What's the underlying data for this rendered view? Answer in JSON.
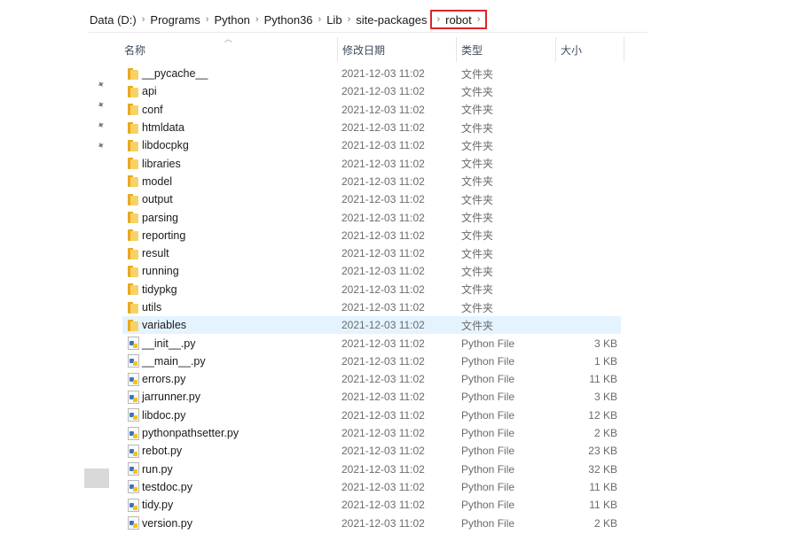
{
  "breadcrumb": {
    "items": [
      "Data (D:)",
      "Programs",
      "Python",
      "Python36",
      "Lib",
      "site-packages"
    ],
    "current": "robot",
    "separator": "›"
  },
  "columns": {
    "name": "名称",
    "date": "修改日期",
    "type": "类型",
    "size": "大小"
  },
  "colors": {
    "highlight_border": "#e0242b",
    "selected_row": "#e5f3ff"
  },
  "files": [
    {
      "icon": "folder-icon",
      "name": "__pycache__",
      "date": "2021-12-03 11:02",
      "type": "文件夹",
      "size": ""
    },
    {
      "icon": "folder-icon",
      "name": "api",
      "date": "2021-12-03 11:02",
      "type": "文件夹",
      "size": ""
    },
    {
      "icon": "folder-icon",
      "name": "conf",
      "date": "2021-12-03 11:02",
      "type": "文件夹",
      "size": ""
    },
    {
      "icon": "folder-icon",
      "name": "htmldata",
      "date": "2021-12-03 11:02",
      "type": "文件夹",
      "size": ""
    },
    {
      "icon": "folder-icon",
      "name": "libdocpkg",
      "date": "2021-12-03 11:02",
      "type": "文件夹",
      "size": ""
    },
    {
      "icon": "folder-icon",
      "name": "libraries",
      "date": "2021-12-03 11:02",
      "type": "文件夹",
      "size": ""
    },
    {
      "icon": "folder-icon",
      "name": "model",
      "date": "2021-12-03 11:02",
      "type": "文件夹",
      "size": ""
    },
    {
      "icon": "folder-icon",
      "name": "output",
      "date": "2021-12-03 11:02",
      "type": "文件夹",
      "size": ""
    },
    {
      "icon": "folder-icon",
      "name": "parsing",
      "date": "2021-12-03 11:02",
      "type": "文件夹",
      "size": ""
    },
    {
      "icon": "folder-icon",
      "name": "reporting",
      "date": "2021-12-03 11:02",
      "type": "文件夹",
      "size": ""
    },
    {
      "icon": "folder-icon",
      "name": "result",
      "date": "2021-12-03 11:02",
      "type": "文件夹",
      "size": ""
    },
    {
      "icon": "folder-icon",
      "name": "running",
      "date": "2021-12-03 11:02",
      "type": "文件夹",
      "size": ""
    },
    {
      "icon": "folder-icon",
      "name": "tidypkg",
      "date": "2021-12-03 11:02",
      "type": "文件夹",
      "size": ""
    },
    {
      "icon": "folder-icon",
      "name": "utils",
      "date": "2021-12-03 11:02",
      "type": "文件夹",
      "size": ""
    },
    {
      "icon": "folder-icon",
      "name": "variables",
      "date": "2021-12-03 11:02",
      "type": "文件夹",
      "size": "",
      "selected": true
    },
    {
      "icon": "python-file-icon",
      "name": "__init__.py",
      "date": "2021-12-03 11:02",
      "type": "Python File",
      "size": "3 KB"
    },
    {
      "icon": "python-file-icon",
      "name": "__main__.py",
      "date": "2021-12-03 11:02",
      "type": "Python File",
      "size": "1 KB"
    },
    {
      "icon": "python-file-icon",
      "name": "errors.py",
      "date": "2021-12-03 11:02",
      "type": "Python File",
      "size": "11 KB"
    },
    {
      "icon": "python-file-icon",
      "name": "jarrunner.py",
      "date": "2021-12-03 11:02",
      "type": "Python File",
      "size": "3 KB"
    },
    {
      "icon": "python-file-icon",
      "name": "libdoc.py",
      "date": "2021-12-03 11:02",
      "type": "Python File",
      "size": "12 KB"
    },
    {
      "icon": "python-file-icon",
      "name": "pythonpathsetter.py",
      "date": "2021-12-03 11:02",
      "type": "Python File",
      "size": "2 KB"
    },
    {
      "icon": "python-file-icon",
      "name": "rebot.py",
      "date": "2021-12-03 11:02",
      "type": "Python File",
      "size": "23 KB"
    },
    {
      "icon": "python-file-icon",
      "name": "run.py",
      "date": "2021-12-03 11:02",
      "type": "Python File",
      "size": "32 KB"
    },
    {
      "icon": "python-file-icon",
      "name": "testdoc.py",
      "date": "2021-12-03 11:02",
      "type": "Python File",
      "size": "11 KB"
    },
    {
      "icon": "python-file-icon",
      "name": "tidy.py",
      "date": "2021-12-03 11:02",
      "type": "Python File",
      "size": "11 KB"
    },
    {
      "icon": "python-file-icon",
      "name": "version.py",
      "date": "2021-12-03 11:02",
      "type": "Python File",
      "size": "2 KB"
    }
  ]
}
